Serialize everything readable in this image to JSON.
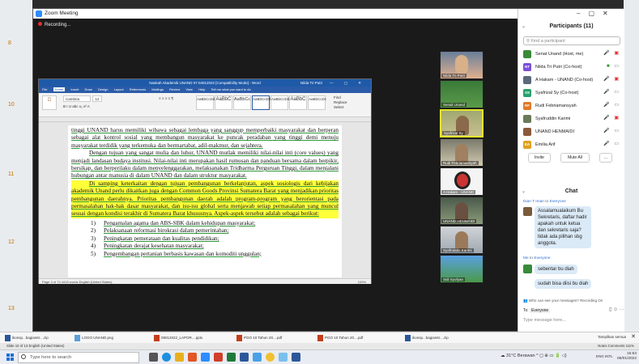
{
  "zoom": {
    "title": "Zoom Meeting",
    "recording": "Recording..."
  },
  "word": {
    "title": "Naskah Akademik UNAND 07.04012022 [Compatibility Mode] - Word",
    "user": "Nilda Tri Putri",
    "tabs": [
      "File",
      "Home",
      "Insert",
      "Draw",
      "Design",
      "Layout",
      "References",
      "Mailings",
      "Review",
      "View",
      "Help",
      "Tell me what you want to do"
    ],
    "font": "Cambria",
    "font_size": "12",
    "styles": [
      "AaBbCcDd",
      "AaBbC",
      "AaBbCc",
      "AaBbCcDd",
      "AaBbCcDd",
      "AaBbC",
      "AaBbCcDc"
    ],
    "style_names": [
      "1 Emphasis",
      "Heading 1",
      "Heading 2",
      "1 Normal",
      "Strong",
      "Subtitle",
      "Title",
      "Subtle Em...",
      "Intense E..."
    ],
    "editing": [
      "Find",
      "Replace",
      "Select"
    ],
    "status": "Page 3 of 74   4415 words   English (United States)",
    "zoom_pct": "100%",
    "doc": {
      "p1": "tinggi UNAND harus memiliki wibawa sebagai lembaga yang sanggup memperbaiki masyarakat dan berperan sebagai alat kontrol sosial yang membangun masyarakat ke puncak peradaban yang tinggi demi menuju masyarakat terdidik yang terkemuka dan bermartabat, adil-makmur, dan sejahtera.",
      "p2": "Dengan tujuan yang sangat mulia dan luhur, UNAND mutlak memiliki nilai-nilai inti (core values) yang menjadi landasan budaya institusi. Nilai-nilai inti merupakan hasil rumusan dan panduan bersama dalam berpikir, bersikap, dan berperilaku dalam menyelenggarakan, melaksanakan Tridharma Perguruan Tinggi, dalam menjalani hubungan antar manusia di dalam UNAND dan dalam struktur masyarakat.",
      "p3": "Di samping keterkaitan dengan tujuan pembangunan berkelanjutan, aspek sosiologis dari kebijakan akademik Unand perlu dikaitkan juga dengan Common Goods Provinsi Sumatera Barat yang menjadikan prioritas pembangunan daerahnya. Prioritas pembangunan daerah adalah program-program yang berorientasi pada permasalahan hak-hak dasar masyarakat, dan isu-isu global serta menjawab setiap permasalahan yang muncul sesuai dengan kondisi terakhir di Sumatera Barat khususnya. Aspek-aspek tersebut adalah sebagai berikut:",
      "list": [
        {
          "n": "1)",
          "t": "Pengamalan agama dan ABS-SBK dalam kehidupan masyarakat;"
        },
        {
          "n": "2)",
          "t": "Pelaksanaan reformasi birokrasi dalam pemerintahan;"
        },
        {
          "n": "3)",
          "t": "Peningkatan pemerataan dan kualitas pendidikan;"
        },
        {
          "n": "4)",
          "t": "Peningkatan derajat kesehatan masyarakat;"
        },
        {
          "n": "5)",
          "t": "Pengembangan pertanian berbasis kawasan dan komoditi unggulan;"
        }
      ]
    }
  },
  "gallery": [
    {
      "name": "Nilda Tri Putri",
      "active": false
    },
    {
      "name": "Senali Unand",
      "active": false
    },
    {
      "name": "Syafrizal Sy",
      "active": true
    },
    {
      "name": "Rudi Febriamansyah",
      "active": false
    },
    {
      "name": "A Hakam - UNAND",
      "active": false
    },
    {
      "name": "UNAND HENMAIDI",
      "active": false
    },
    {
      "name": "Syafruddin Karimi",
      "active": false
    },
    {
      "name": "Sidi Syofyan",
      "active": false
    }
  ],
  "participants": {
    "title": "Participants (11)",
    "find_placeholder": "Find a participant",
    "list": [
      {
        "initials": "",
        "name": "Senat Unand (Host, me)",
        "color": "#3a8a3a"
      },
      {
        "initials": "NT",
        "name": "Nilda Tri Putri (Co-host)",
        "color": "#7b4fd6"
      },
      {
        "initials": "",
        "name": "A Hakam - UNAND (Co-host)",
        "color": "#5a6a7a"
      },
      {
        "initials": "SS",
        "name": "Syafrizal Sy (Co-host)",
        "color": "#2aa06a"
      },
      {
        "initials": "RF",
        "name": "Rudi Febriamansyah",
        "color": "#e07a2a"
      },
      {
        "initials": "",
        "name": "Syafruddin Karimi",
        "color": "#6a7a5a"
      },
      {
        "initials": "",
        "name": "UNAND HENMAIDI",
        "color": "#8a5a3a"
      },
      {
        "initials": "EA",
        "name": "Emilia Arif",
        "color": "#e0a020"
      }
    ],
    "invite": "Invite",
    "mute_all": "Mute All",
    "more": "..."
  },
  "chat": {
    "title": "Chat",
    "from1": "Dian T Iman",
    "to1": "to",
    "everyone1": "Everyone",
    "msg1": "Assalamualaikum Bu Sekretaris, daftar hadir apakah untuk ketua dan sekretaris saja? tidak ada pilihan sbg anggota.",
    "from2": "Me",
    "to2": "to",
    "everyone2": "Everyone",
    "msg2": "sebentar bu diah",
    "msg3": "sudah bisa diisi bu diah",
    "notice": "Who can see your messages? Recording On",
    "to_label": "To:",
    "to_value": "Everyone",
    "placeholder": "Type message here..."
  },
  "downloads": [
    {
      "name": "ikonsp...bagian6r....zip",
      "type": "doc"
    },
    {
      "name": "LOGO UNAND.png",
      "type": "png"
    },
    {
      "name": "08012022_LAPOR....pptx",
      "type": "ppt"
    },
    {
      "name": "PGO 10 Tahun 20....pdf",
      "type": "ppt"
    },
    {
      "name": "PGO 10 Tahun 20....pdf",
      "type": "ppt"
    },
    {
      "name": "ikonsp...bagian6r....zip",
      "type": "doc"
    }
  ],
  "downloads_show_all": "Tampilkan semua",
  "statusbar": {
    "left": "Slide 10 of 13    English (United States)",
    "right": "Notes   Comments   111%"
  },
  "taskbar": {
    "search": "Type here to search",
    "weather": "31°C Berawan",
    "lang": "ENG INTL",
    "time": "15:53",
    "date": "06/01/2022"
  },
  "bg_numbers": [
    "8",
    "10",
    "11",
    "12",
    "13"
  ]
}
